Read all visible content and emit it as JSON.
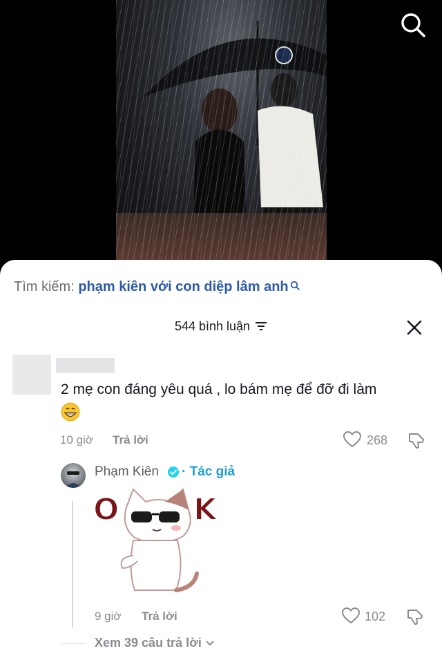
{
  "video": {
    "search_icon": "search-icon"
  },
  "search": {
    "prefix": "Tìm kiếm:",
    "query": "phạm kiên với con diệp lâm anh"
  },
  "comments_header": {
    "count_label": "544 bình luận",
    "filter_icon": "filter-icon",
    "close_icon": "close-icon"
  },
  "comment": {
    "text": "2 mẹ con đáng yêu quá , lo bám mẹ để đỡ đi làm",
    "emoji": "grinning-face",
    "time": "10 giờ",
    "reply_label": "Trả lời",
    "likes": "268"
  },
  "reply": {
    "author": "Phạm Kiên",
    "dot": "·",
    "author_tag": "Tác giả",
    "sticker_text_left": "O",
    "sticker_text_right": "K",
    "time": "9 giờ",
    "reply_label": "Trả lời",
    "likes": "102"
  },
  "view_more": {
    "label": "Xem 39 câu trả lời"
  },
  "colors": {
    "link_blue": "#2b5aa8",
    "author_blue": "#1f9ed9",
    "muted": "#8a8b91",
    "text": "#161823"
  }
}
